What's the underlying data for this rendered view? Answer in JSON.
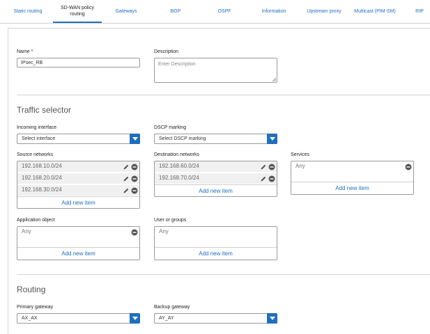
{
  "tabs": [
    {
      "label": "Static routing",
      "active": false
    },
    {
      "label": "SD-WAN policy routing",
      "active": true
    },
    {
      "label": "Gateways",
      "active": false
    },
    {
      "label": "BGP",
      "active": false
    },
    {
      "label": "OSPF",
      "active": false
    },
    {
      "label": "Information",
      "active": false
    },
    {
      "label": "Upstream proxy",
      "active": false
    },
    {
      "label": "Multicast (PIM-SM)",
      "active": false
    },
    {
      "label": "RIP",
      "active": false
    }
  ],
  "form": {
    "name_label": "Name *",
    "name_value": "IPsec_RB",
    "description_label": "Description",
    "description_placeholder": "Enter Description"
  },
  "traffic_selector": {
    "title": "Traffic selector",
    "incoming_interface_label": "Incoming interface",
    "incoming_interface_value": "Select interface",
    "dscp_label": "DSCP marking",
    "dscp_value": "Select DSCP marking",
    "source_label": "Source networks",
    "source_items": [
      "192.168.10.0/24",
      "192.168.20.0/24",
      "192.168.30.0/24"
    ],
    "destination_label": "Destination networks",
    "destination_items": [
      "192.168.60.0/24",
      "192.168.70.0/24"
    ],
    "services_label": "Services",
    "services_items": [
      "Any"
    ],
    "application_label": "Application object",
    "application_items": [
      "Any"
    ],
    "users_label": "User or groups",
    "users_items": [
      "Any"
    ],
    "add_new_item": "Add new item"
  },
  "routing": {
    "title": "Routing",
    "primary_label": "Primary gateway",
    "primary_value": "AX_AX",
    "backup_label": "Backup gateway",
    "backup_value": "AY_AY"
  },
  "colors": {
    "accent": "#1f6fbf",
    "row_bg": "#f0f0f0",
    "border": "#9a9a9a"
  },
  "icons": {
    "edit": "pencil-icon",
    "remove": "minus-circle-icon",
    "dropdown": "chevron-down-icon"
  }
}
